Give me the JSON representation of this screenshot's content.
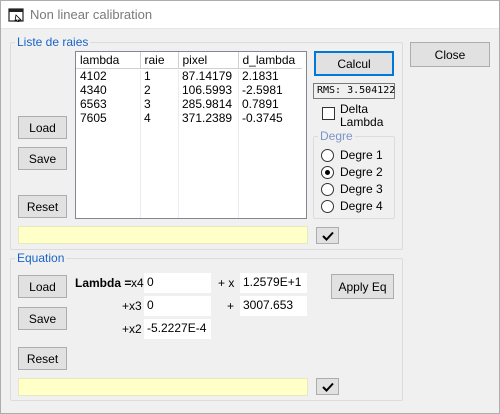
{
  "window": {
    "title": "Non linear calibration"
  },
  "buttons": {
    "close": "Close",
    "calcul": "Calcul",
    "load_top": "Load",
    "save_top": "Save",
    "reset_top": "Reset",
    "load_bottom": "Load",
    "save_bottom": "Save",
    "reset_bottom": "Reset",
    "apply_eq": "Apply Eq"
  },
  "liste": {
    "group_label": "Liste de raies",
    "columns": [
      "lambda",
      "raie",
      "pixel",
      "d_lambda"
    ],
    "rows": [
      [
        "4102",
        "1",
        "87.14179",
        "2.1831"
      ],
      [
        "4340",
        "2",
        "106.5993",
        "-2.5981"
      ],
      [
        "6563",
        "3",
        "285.9814",
        "0.7891"
      ],
      [
        "7605",
        "4",
        "371.2389",
        "-0.3745"
      ]
    ],
    "status_text": ""
  },
  "rms": {
    "label": "RMS:",
    "value": "3.504122"
  },
  "delta_lambda": {
    "label_line1": "Delta",
    "label_line2": "Lambda",
    "checked": false
  },
  "degre": {
    "group_label": "Degre",
    "options": [
      "Degre 1",
      "Degre 2",
      "Degre 3",
      "Degre 4"
    ],
    "selected_index": 1
  },
  "equation": {
    "group_label": "Equation",
    "lambda_label": "Lambda =",
    "x4_label": "x4",
    "x4_value": "0",
    "x_label": "+ x",
    "x_value": "1.2579E+1",
    "x3_label": "+x3",
    "x3_value": "0",
    "plus_label": "+",
    "const_value": "3007.653",
    "x2_label": "+x2",
    "x2_value": "-5.2227E-4",
    "status_text": ""
  },
  "icons": {
    "app": "window-app-icon",
    "check": "checkmark-icon"
  }
}
